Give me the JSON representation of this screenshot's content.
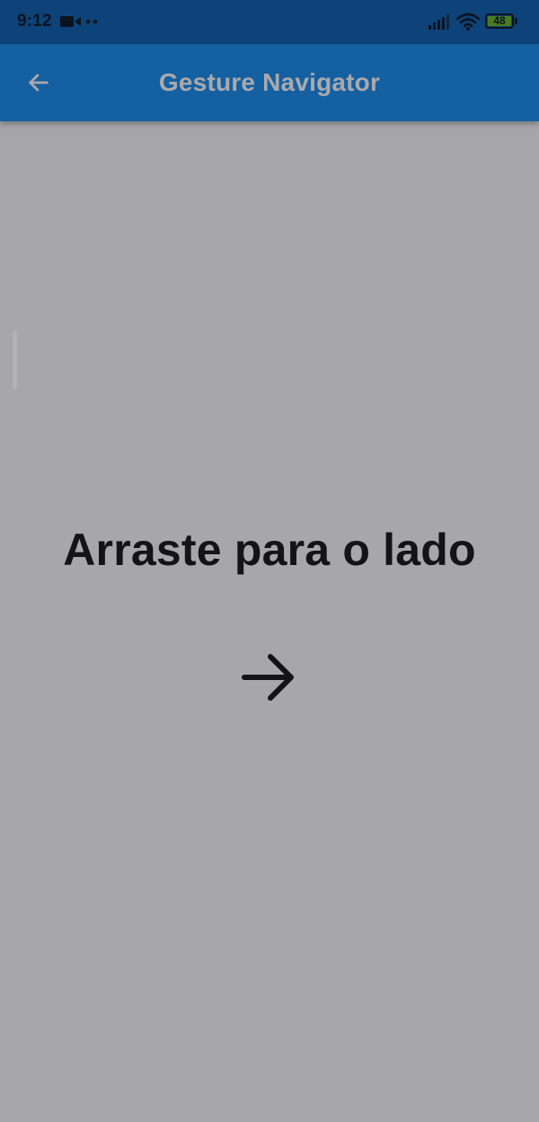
{
  "status_bar": {
    "time": "9:12",
    "battery_level": "48",
    "icons": [
      "video-camera-icon",
      "notification-dots-icon",
      "cell-signal-icon",
      "wifi-icon",
      "battery-icon"
    ]
  },
  "app_bar": {
    "title": "Gesture Navigator",
    "back_icon": "arrow-back-icon"
  },
  "main": {
    "instruction": "Arraste para o lado",
    "direction_icon": "arrow-forward-icon"
  },
  "colors": {
    "status_bar": "#0d4378",
    "app_bar": "#1560a1",
    "background": "#a7a6a9",
    "text": "#141417",
    "title": "#a9a9ac",
    "battery_fill": "#4a7c1e"
  }
}
